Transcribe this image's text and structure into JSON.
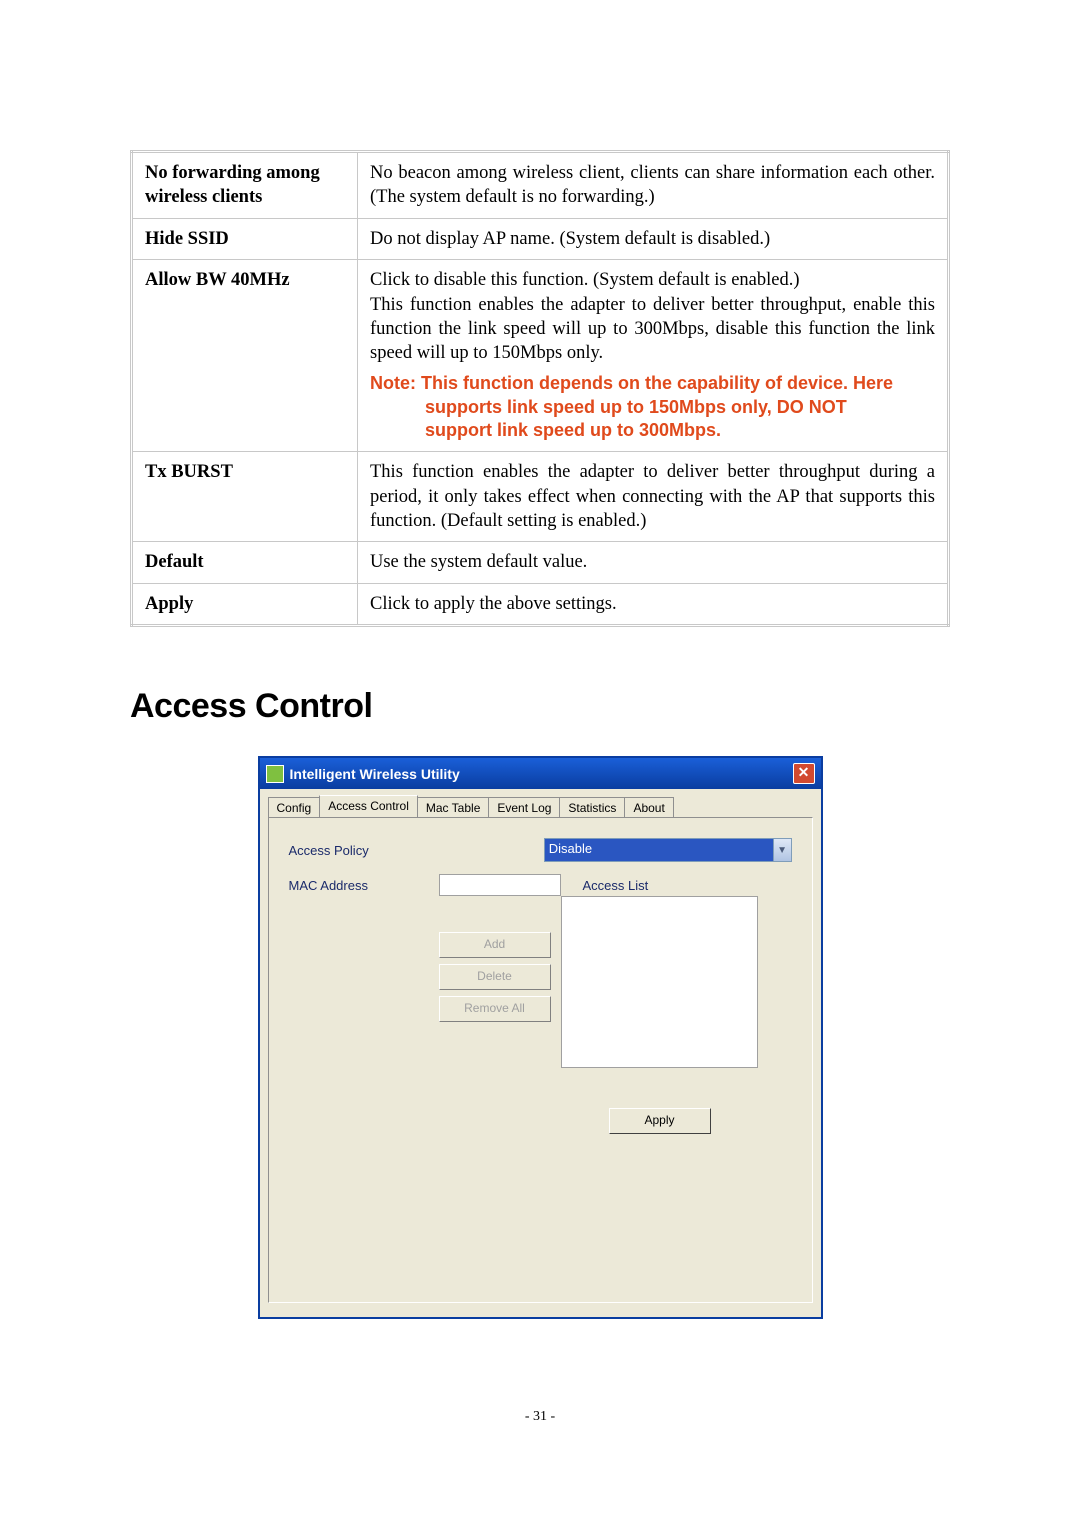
{
  "table": {
    "rows": [
      {
        "label": "No forwarding among wireless clients",
        "desc": "No beacon among wireless client, clients can share information each other. (The system default is no forwarding.)",
        "justify": true
      },
      {
        "label": "Hide SSID",
        "desc": "Do not display AP name. (System default is disabled.)"
      },
      {
        "label": "Allow BW 40MHz",
        "desc": "Click to disable this function. (System default is enabled.)\nThis function enables the adapter to deliver better throughput, enable this function the link speed will up to 300Mbps, disable this function the link speed will up to 150Mbps only.",
        "note_line1": "Note: This function depends on the capability of device. Here",
        "note_line2": "supports link speed up to 150Mbps only, DO NOT",
        "note_line3": "support link speed up to 300Mbps.",
        "justify": true
      },
      {
        "label": "Tx BURST",
        "desc": "This function enables the adapter to deliver better throughput during a period, it only takes effect when connecting with the AP that supports this function. (Default setting is enabled.)",
        "justify": true
      },
      {
        "label": "Default",
        "desc": "Use the system default value."
      },
      {
        "label": "Apply",
        "desc": "Click to apply the above settings."
      }
    ]
  },
  "section_title": "Access Control",
  "dialog": {
    "title": "Intelligent Wireless Utility",
    "close_label": "✕",
    "tabs": [
      "Config",
      "Access Control",
      "Mac Table",
      "Event Log",
      "Statistics",
      "About"
    ],
    "active_tab_index": 1,
    "access_policy_label": "Access Policy",
    "access_policy_value": "Disable",
    "mac_address_label": "MAC Address",
    "access_list_label": "Access List",
    "add_label": "Add",
    "delete_label": "Delete",
    "remove_all_label": "Remove All",
    "apply_label": "Apply"
  },
  "page_number": "- 31 -"
}
